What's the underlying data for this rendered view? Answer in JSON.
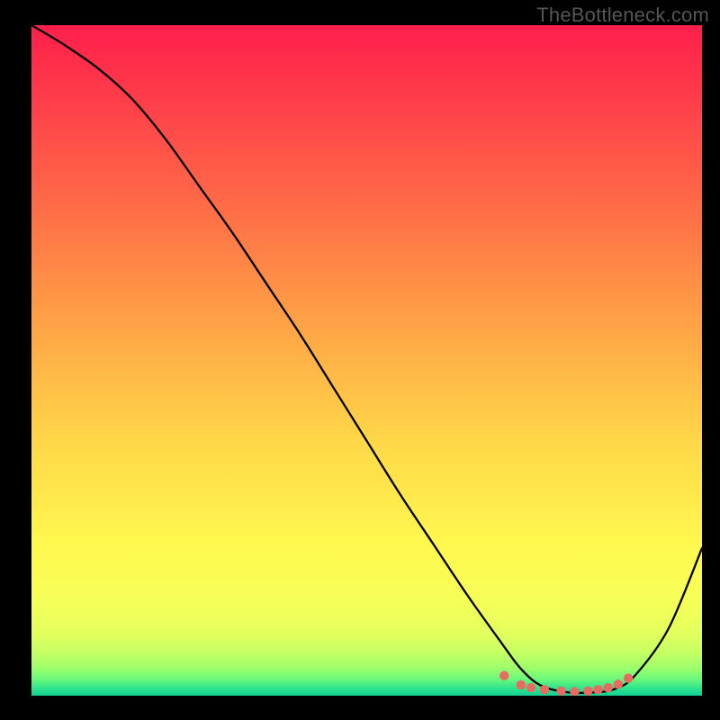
{
  "watermark": "TheBottleneck.com",
  "chart_data": {
    "type": "line",
    "title": "",
    "xlabel": "",
    "ylabel": "",
    "xlim": [
      0,
      100
    ],
    "ylim": [
      0,
      100
    ],
    "series": [
      {
        "name": "bottleneck-curve",
        "x": [
          0,
          5,
          10,
          15,
          20,
          25,
          30,
          35,
          40,
          45,
          50,
          55,
          60,
          65,
          70,
          73,
          76,
          80,
          84,
          87,
          90,
          95,
          100
        ],
        "values": [
          100,
          97,
          93.5,
          89,
          83,
          76,
          69,
          61.5,
          54,
          46,
          38,
          30,
          22.5,
          15,
          8,
          4,
          1.5,
          0.5,
          0.5,
          1,
          3,
          10,
          22
        ]
      },
      {
        "name": "highlight-dots",
        "x": [
          70.5,
          73,
          74.5,
          76.5,
          79,
          81,
          83,
          84.5,
          86,
          87.5,
          89
        ],
        "values": [
          3.0,
          1.6,
          1.2,
          0.9,
          0.7,
          0.6,
          0.7,
          0.9,
          1.2,
          1.7,
          2.6
        ]
      }
    ],
    "gradient_stops": [
      {
        "offset": 0.0,
        "color": "#ff1f4b"
      },
      {
        "offset": 0.1,
        "color": "#ff3a4a"
      },
      {
        "offset": 0.28,
        "color": "#ff6e47"
      },
      {
        "offset": 0.45,
        "color": "#ffa446"
      },
      {
        "offset": 0.62,
        "color": "#ffd748"
      },
      {
        "offset": 0.78,
        "color": "#fff94f"
      },
      {
        "offset": 0.86,
        "color": "#f6ff58"
      },
      {
        "offset": 0.905,
        "color": "#e4ff5d"
      },
      {
        "offset": 0.935,
        "color": "#c6ff63"
      },
      {
        "offset": 0.958,
        "color": "#9eff6a"
      },
      {
        "offset": 0.975,
        "color": "#6cf97a"
      },
      {
        "offset": 0.99,
        "color": "#2be28e"
      },
      {
        "offset": 1.0,
        "color": "#12d196"
      }
    ],
    "highlight_color": "#e86b62"
  }
}
